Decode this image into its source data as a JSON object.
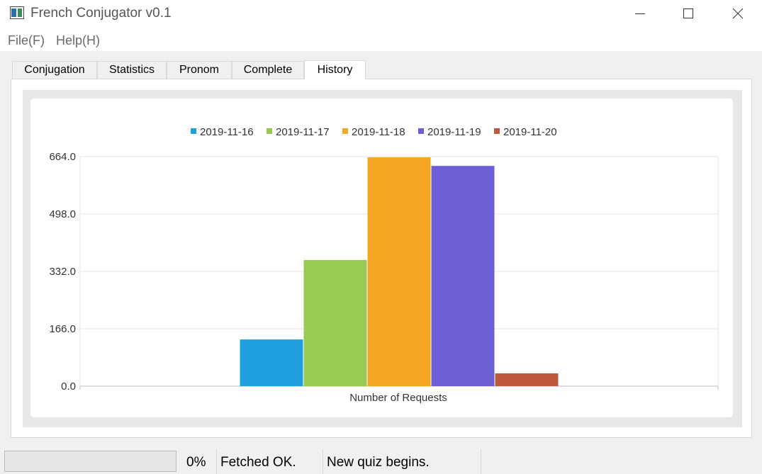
{
  "window": {
    "title": "French Conjugator v0.1"
  },
  "menu": {
    "items": [
      "File(F)",
      "Help(H)"
    ]
  },
  "tabs": [
    {
      "label": "Conjugation",
      "active": false
    },
    {
      "label": "Statistics",
      "active": false
    },
    {
      "label": "Pronom",
      "active": false
    },
    {
      "label": "Complete",
      "active": false
    },
    {
      "label": "History",
      "active": true
    }
  ],
  "chart_data": {
    "type": "bar",
    "categories": [
      "Number of Requests"
    ],
    "series": [
      {
        "name": "2019-11-16",
        "values": [
          135
        ],
        "color": "#209fdf"
      },
      {
        "name": "2019-11-17",
        "values": [
          365
        ],
        "color": "#99ca53"
      },
      {
        "name": "2019-11-18",
        "values": [
          662
        ],
        "color": "#f6a625"
      },
      {
        "name": "2019-11-19",
        "values": [
          637
        ],
        "color": "#6d5fd5"
      },
      {
        "name": "2019-11-20",
        "values": [
          37
        ],
        "color": "#bf593e"
      }
    ],
    "ylim": [
      0,
      664
    ],
    "yticks": [
      "0.0",
      "166.0",
      "332.0",
      "498.0",
      "664.0"
    ],
    "legend": "top-center",
    "grid": true
  },
  "status": {
    "progress_value": 0,
    "progress_label": "0%",
    "message1": "Fetched OK.",
    "message2": "New quiz begins."
  }
}
